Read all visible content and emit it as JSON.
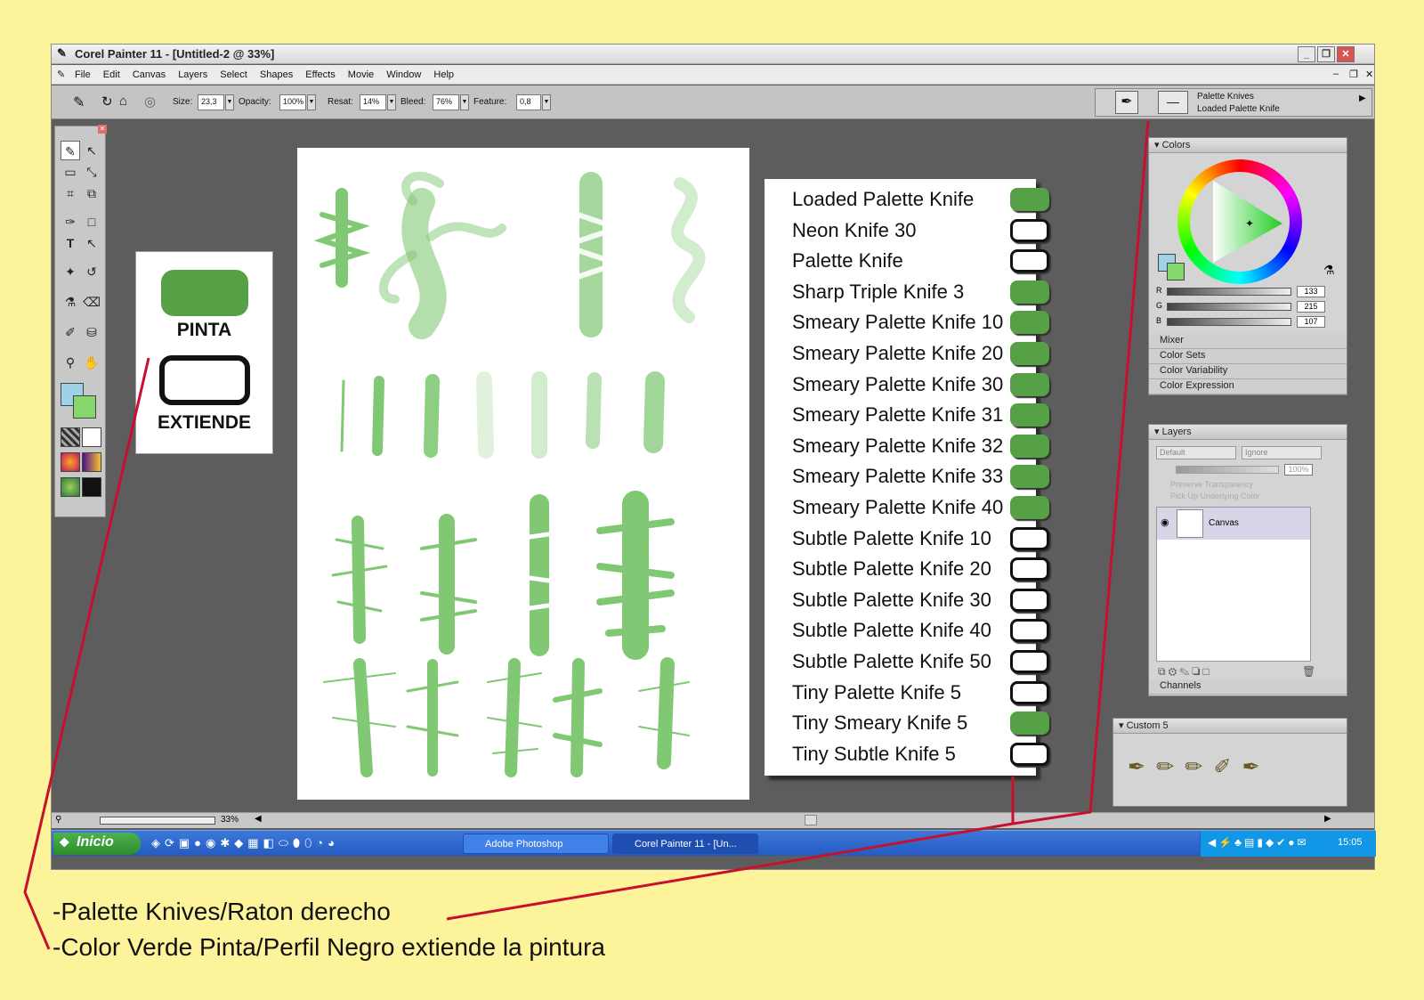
{
  "window": {
    "title": "Corel Painter 11 - [Untitled-2 @ 33%]",
    "buttons": [
      "_",
      "❐",
      "✕"
    ]
  },
  "menu": [
    "File",
    "Edit",
    "Canvas",
    "Layers",
    "Select",
    "Shapes",
    "Effects",
    "Movie",
    "Window",
    "Help"
  ],
  "properties": {
    "size_label": "Size:",
    "size_value": "23,3",
    "opacity_label": "Opacity:",
    "opacity_value": "100%",
    "resat_label": "Resat:",
    "resat_value": "14%",
    "bleed_label": "Bleed:",
    "bleed_value": "76%",
    "feature_label": "Feature:",
    "feature_value": "0,8"
  },
  "brush_selector": {
    "category": "Palette Knives",
    "variant": "Loaded Palette Knife"
  },
  "brush_list": [
    {
      "name": "Loaded Palette Knife",
      "paints": true
    },
    {
      "name": "Neon Knife 30",
      "paints": false
    },
    {
      "name": "Palette Knife",
      "paints": false
    },
    {
      "name": "Sharp Triple Knife 3",
      "paints": true
    },
    {
      "name": "Smeary Palette Knife 10",
      "paints": true
    },
    {
      "name": "Smeary Palette Knife 20",
      "paints": true
    },
    {
      "name": "Smeary Palette Knife 30",
      "paints": true
    },
    {
      "name": "Smeary Palette Knife 31",
      "paints": true
    },
    {
      "name": "Smeary Palette Knife 32",
      "paints": true
    },
    {
      "name": "Smeary Palette Knife 33",
      "paints": true
    },
    {
      "name": "Smeary Palette Knife 40",
      "paints": true
    },
    {
      "name": "Subtle Palette Knife 10",
      "paints": false
    },
    {
      "name": "Subtle Palette Knife 20",
      "paints": false
    },
    {
      "name": "Subtle Palette Knife 30",
      "paints": false
    },
    {
      "name": "Subtle Palette Knife 40",
      "paints": false
    },
    {
      "name": "Subtle Palette Knife 50",
      "paints": false
    },
    {
      "name": "Tiny Palette Knife 5",
      "paints": false
    },
    {
      "name": "Tiny Smeary Knife 5",
      "paints": true
    },
    {
      "name": "Tiny Subtle Knife 5",
      "paints": false
    }
  ],
  "colors_panel": {
    "title": "Colors",
    "r_label": "R",
    "r_value": "133",
    "g_label": "G",
    "g_value": "215",
    "b_label": "B",
    "b_value": "107",
    "collapsed": [
      "Mixer",
      "Color Sets",
      "Color Variability",
      "Color Expression"
    ]
  },
  "layers_panel": {
    "title": "Layers",
    "composite": "Default",
    "depth": "Ignore",
    "opacity": "100%",
    "preserve": "Preserve Transparency",
    "pick_underlying": "Pick Up Underlying Color",
    "layer_name": "Canvas",
    "channels": "Channels"
  },
  "custom_panel": {
    "title": "Custom 5"
  },
  "statusbar": {
    "zoom": "33%"
  },
  "legend": {
    "paint_label": "PINTA",
    "smear_label": "EXTIENDE"
  },
  "taskbar": {
    "start": "Inicio",
    "tasks": [
      "Adobe Photoshop",
      "Corel Painter 11 - [Un..."
    ],
    "clock": "15:05"
  },
  "captions": [
    "-Palette Knives/Raton derecho",
    "-Color Verde Pinta/Perfil Negro extiende la pintura"
  ],
  "colors": {
    "background": "#fdf39b",
    "paint_green": "#56a046",
    "annotation_red": "#c8102e"
  }
}
